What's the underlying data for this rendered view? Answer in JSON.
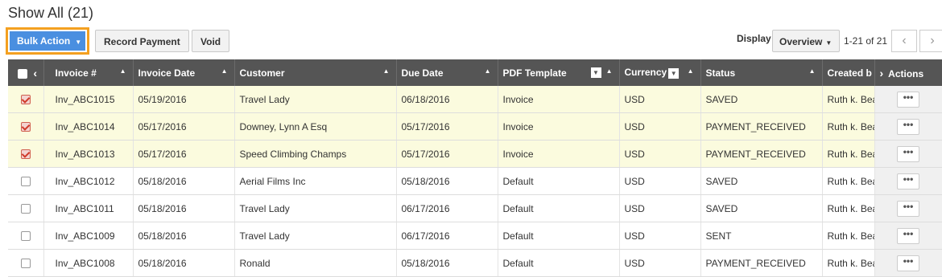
{
  "page": {
    "title": "Show All (21)"
  },
  "toolbar": {
    "bulk_action": "Bulk Action",
    "record_payment": "Record Payment",
    "void": "Void",
    "display_label": "Display",
    "overview": "Overview",
    "pager_text": "1-21 of 21",
    "prev": "‹",
    "next": "›"
  },
  "table": {
    "headers": {
      "invoice_no": "Invoice #",
      "invoice_date": "Invoice Date",
      "customer": "Customer",
      "due_date": "Due Date",
      "pdf_template": "PDF Template",
      "currency": "Currency",
      "status": "Status",
      "created_by": "Created b",
      "actions": "Actions"
    },
    "rows": [
      {
        "selected": true,
        "invoice_no": "Inv_ABC1015",
        "invoice_date": "05/19/2016",
        "customer": "Travel Lady",
        "due_date": "06/18/2016",
        "pdf_template": "Invoice",
        "currency": "USD",
        "status": "SAVED",
        "created_by": "Ruth k. Bea",
        "action": "•••"
      },
      {
        "selected": true,
        "invoice_no": "Inv_ABC1014",
        "invoice_date": "05/17/2016",
        "customer": "Downey, Lynn A Esq",
        "due_date": "05/17/2016",
        "pdf_template": "Invoice",
        "currency": "USD",
        "status": "PAYMENT_RECEIVED",
        "created_by": "Ruth k. Bea",
        "action": "•••"
      },
      {
        "selected": true,
        "invoice_no": "Inv_ABC1013",
        "invoice_date": "05/17/2016",
        "customer": "Speed Climbing Champs",
        "due_date": "05/17/2016",
        "pdf_template": "Invoice",
        "currency": "USD",
        "status": "PAYMENT_RECEIVED",
        "created_by": "Ruth k. Bea",
        "action": "•••"
      },
      {
        "selected": false,
        "invoice_no": "Inv_ABC1012",
        "invoice_date": "05/18/2016",
        "customer": "Aerial Films Inc",
        "due_date": "05/18/2016",
        "pdf_template": "Default",
        "currency": "USD",
        "status": "SAVED",
        "created_by": "Ruth k. Bea",
        "action": "•••"
      },
      {
        "selected": false,
        "invoice_no": "Inv_ABC1011",
        "invoice_date": "05/18/2016",
        "customer": "Travel Lady",
        "due_date": "06/17/2016",
        "pdf_template": "Default",
        "currency": "USD",
        "status": "SAVED",
        "created_by": "Ruth k. Bea",
        "action": "•••"
      },
      {
        "selected": false,
        "invoice_no": "Inv_ABC1009",
        "invoice_date": "05/18/2016",
        "customer": "Travel Lady",
        "due_date": "06/17/2016",
        "pdf_template": "Default",
        "currency": "USD",
        "status": "SENT",
        "created_by": "Ruth k. Bea",
        "action": "•••"
      },
      {
        "selected": false,
        "invoice_no": "Inv_ABC1008",
        "invoice_date": "05/18/2016",
        "customer": "Ronald",
        "due_date": "05/18/2016",
        "pdf_template": "Default",
        "currency": "USD",
        "status": "PAYMENT_RECEIVED",
        "created_by": "Ruth k. Bea",
        "action": "•••"
      }
    ]
  }
}
